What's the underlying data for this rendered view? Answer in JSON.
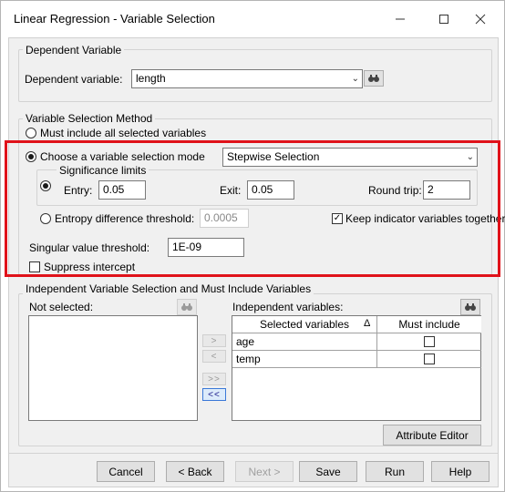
{
  "window": {
    "title": "Linear Regression - Variable Selection"
  },
  "dependent": {
    "group_label": "Dependent Variable",
    "field_label": "Dependent variable:",
    "value": "length"
  },
  "method": {
    "group_label": "Variable Selection Method",
    "must_include_all_label": "Must include all selected variables",
    "choose_mode_label": "Choose a variable selection mode",
    "mode_value": "Stepwise Selection",
    "significance_group_label": "Significance limits",
    "entry_label": "Entry:",
    "entry_value": "0.05",
    "exit_label": "Exit:",
    "exit_value": "0.05",
    "round_trip_label": "Round trip:",
    "round_trip_value": "2",
    "entropy_label": "Entropy difference threshold:",
    "entropy_value": "0.0005",
    "keep_indicator_label": "Keep indicator  variables together",
    "keep_indicator_checked": true,
    "singular_label": "Singular value threshold:",
    "singular_value": "1E-09",
    "suppress_label": "Suppress intercept",
    "suppress_checked": false,
    "selected_mode": "choose"
  },
  "independent": {
    "group_label": "Independent Variable Selection and Must Include Variables",
    "not_selected_label": "Not selected:",
    "independent_label": "Independent variables:",
    "move_right": ">",
    "move_left": "<",
    "move_all_right": ">>",
    "move_all_left": "<<",
    "table_headers": [
      "Selected variables",
      "Must include"
    ],
    "sort_glyph": "Δ",
    "rows": [
      {
        "name": "age",
        "must_include": false
      },
      {
        "name": "temp",
        "must_include": false
      }
    ],
    "attribute_editor_label": "Attribute Editor"
  },
  "footer": {
    "cancel": "Cancel",
    "back": "< Back",
    "next": "Next >",
    "save": "Save",
    "run": "Run",
    "help": "Help"
  },
  "colors": {
    "highlight_border": "#e0121a",
    "dialog_bg": "#f0f0f0"
  }
}
